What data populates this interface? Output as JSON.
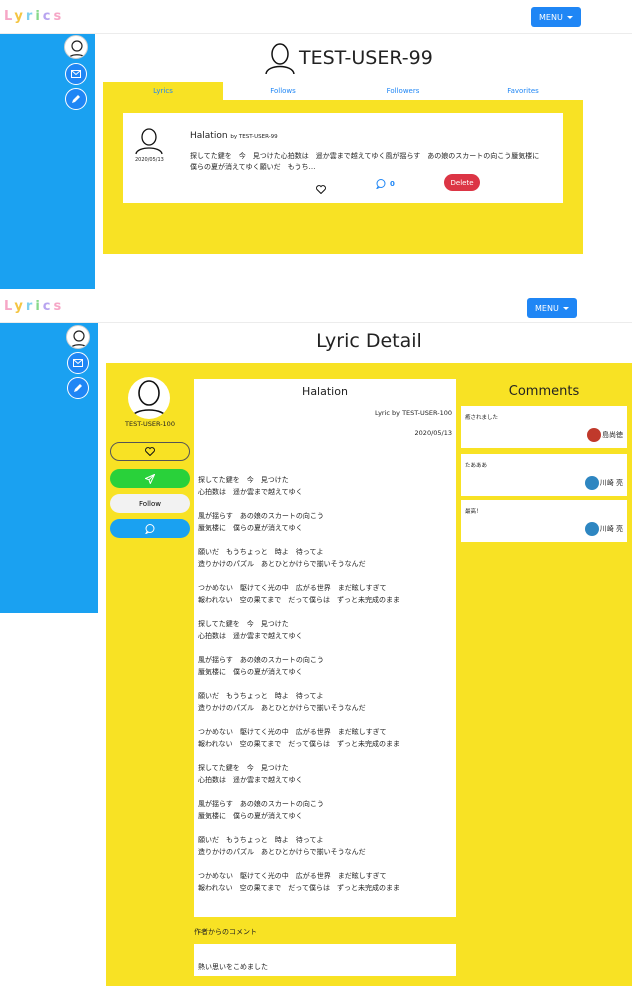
{
  "brand": {
    "letters": [
      "L",
      "y",
      "r",
      "i",
      "c",
      "s"
    ],
    "colors": [
      "#f6a7c6",
      "#f4c542",
      "#7fd0ef",
      "#86d98a",
      "#b8a4ef",
      "#f6a7c6"
    ]
  },
  "nav": {
    "menu_label": "MENU"
  },
  "sidebar": {
    "icons": [
      "user-avatar",
      "mail-icon",
      "pencil-icon"
    ]
  },
  "profile": {
    "username": "TEST-USER-99",
    "tabs": [
      "Lyrics",
      "Follows",
      "Followers",
      "Favorites"
    ],
    "lyric_card": {
      "date": "2020/05/13",
      "title": "Halation",
      "by": "by TEST-USER-99",
      "excerpt": "探してた鍵を　今　見つけた心拍数は　遥か雲まで越えてゆく風が揺らす　あの娘のスカートの向こう蜃気楼に　僕らの夏が消えてゆく願いだ　もうち…",
      "comment_count": "0",
      "delete_label": "Delete"
    }
  },
  "detail": {
    "page_title": "Lyric Detail",
    "author": "TEST-USER-100",
    "follow_label": "Follow",
    "lyric_title": "Halation",
    "lyric_by": "Lyric by TEST-USER-100",
    "lyric_date": "2020/05/13",
    "lyric_body": "探してた鍵を　今　見つけた\n心拍数は　遥か雲まで越えてゆく\n\n風が揺らす　あの娘のスカートの向こう\n蜃気楼に　僕らの夏が消えてゆく\n\n願いだ　もうちょっと　時よ　待ってよ\n造りかけのパズル　あとひとかけらで揃いそうなんだ\n\nつかめない　駆けてく光の中　広がる世界　まだ眩しすぎて\n報われない　空の果てまで　だって僕らは　ずっと未完成のまま\n\n探してた鍵を　今　見つけた\n心拍数は　遥か雲まで越えてゆく\n\n風が揺らす　あの娘のスカートの向こう\n蜃気楼に　僕らの夏が消えてゆく\n\n願いだ　もうちょっと　時よ　待ってよ\n造りかけのパズル　あとひとかけらで揃いそうなんだ\n\nつかめない　駆けてく光の中　広がる世界　まだ眩しすぎて\n報われない　空の果てまで　だって僕らは　ずっと未完成のまま\n\n探してた鍵を　今　見つけた\n心拍数は　遥か雲まで越えてゆく\n\n風が揺らす　あの娘のスカートの向こう\n蜃気楼に　僕らの夏が消えてゆく\n\n願いだ　もうちょっと　時よ　待ってよ\n造りかけのパズル　あとひとかけらで揃いそうなんだ\n\nつかめない　駆けてく光の中　広がる世界　まだ眩しすぎて\n報われない　空の果てまで　だって僕らは　ずっと未完成のまま",
    "author_note_label": "作者からのコメント",
    "author_note": "熱い思いをこめました",
    "comments_title": "Comments",
    "comments": [
      {
        "text": "癒されました",
        "user": "島尚徳",
        "avatar_color": "#c0392b"
      },
      {
        "text": "たあああ",
        "user": "川崎 亮",
        "avatar_color": "#2e86c1"
      },
      {
        "text": "最高！",
        "user": "川崎 亮",
        "avatar_color": "#2e86c1"
      }
    ]
  },
  "colors": {
    "accent": "#1f86f5",
    "sidebar": "#1aa1f1",
    "panel": "#f8e224",
    "danger": "#dc3545",
    "success": "#29d13a"
  }
}
